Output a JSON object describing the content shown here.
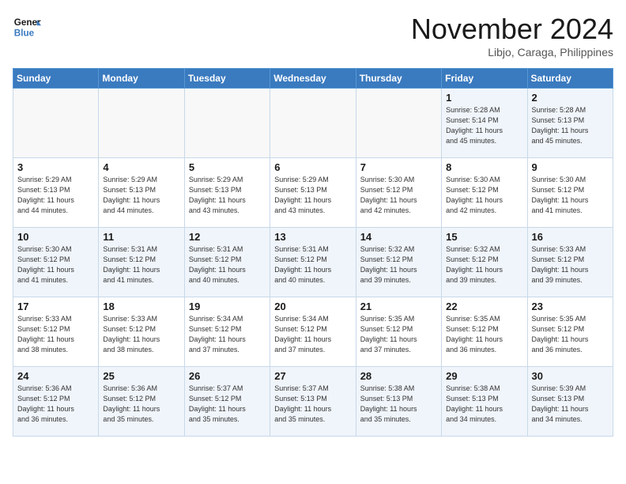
{
  "logo": {
    "line1": "General",
    "line2": "Blue"
  },
  "title": "November 2024",
  "location": "Libjo, Caraga, Philippines",
  "weekdays": [
    "Sunday",
    "Monday",
    "Tuesday",
    "Wednesday",
    "Thursday",
    "Friday",
    "Saturday"
  ],
  "weeks": [
    [
      {
        "day": "",
        "info": ""
      },
      {
        "day": "",
        "info": ""
      },
      {
        "day": "",
        "info": ""
      },
      {
        "day": "",
        "info": ""
      },
      {
        "day": "",
        "info": ""
      },
      {
        "day": "1",
        "info": "Sunrise: 5:28 AM\nSunset: 5:14 PM\nDaylight: 11 hours\nand 45 minutes."
      },
      {
        "day": "2",
        "info": "Sunrise: 5:28 AM\nSunset: 5:13 PM\nDaylight: 11 hours\nand 45 minutes."
      }
    ],
    [
      {
        "day": "3",
        "info": "Sunrise: 5:29 AM\nSunset: 5:13 PM\nDaylight: 11 hours\nand 44 minutes."
      },
      {
        "day": "4",
        "info": "Sunrise: 5:29 AM\nSunset: 5:13 PM\nDaylight: 11 hours\nand 44 minutes."
      },
      {
        "day": "5",
        "info": "Sunrise: 5:29 AM\nSunset: 5:13 PM\nDaylight: 11 hours\nand 43 minutes."
      },
      {
        "day": "6",
        "info": "Sunrise: 5:29 AM\nSunset: 5:13 PM\nDaylight: 11 hours\nand 43 minutes."
      },
      {
        "day": "7",
        "info": "Sunrise: 5:30 AM\nSunset: 5:12 PM\nDaylight: 11 hours\nand 42 minutes."
      },
      {
        "day": "8",
        "info": "Sunrise: 5:30 AM\nSunset: 5:12 PM\nDaylight: 11 hours\nand 42 minutes."
      },
      {
        "day": "9",
        "info": "Sunrise: 5:30 AM\nSunset: 5:12 PM\nDaylight: 11 hours\nand 41 minutes."
      }
    ],
    [
      {
        "day": "10",
        "info": "Sunrise: 5:30 AM\nSunset: 5:12 PM\nDaylight: 11 hours\nand 41 minutes."
      },
      {
        "day": "11",
        "info": "Sunrise: 5:31 AM\nSunset: 5:12 PM\nDaylight: 11 hours\nand 41 minutes."
      },
      {
        "day": "12",
        "info": "Sunrise: 5:31 AM\nSunset: 5:12 PM\nDaylight: 11 hours\nand 40 minutes."
      },
      {
        "day": "13",
        "info": "Sunrise: 5:31 AM\nSunset: 5:12 PM\nDaylight: 11 hours\nand 40 minutes."
      },
      {
        "day": "14",
        "info": "Sunrise: 5:32 AM\nSunset: 5:12 PM\nDaylight: 11 hours\nand 39 minutes."
      },
      {
        "day": "15",
        "info": "Sunrise: 5:32 AM\nSunset: 5:12 PM\nDaylight: 11 hours\nand 39 minutes."
      },
      {
        "day": "16",
        "info": "Sunrise: 5:33 AM\nSunset: 5:12 PM\nDaylight: 11 hours\nand 39 minutes."
      }
    ],
    [
      {
        "day": "17",
        "info": "Sunrise: 5:33 AM\nSunset: 5:12 PM\nDaylight: 11 hours\nand 38 minutes."
      },
      {
        "day": "18",
        "info": "Sunrise: 5:33 AM\nSunset: 5:12 PM\nDaylight: 11 hours\nand 38 minutes."
      },
      {
        "day": "19",
        "info": "Sunrise: 5:34 AM\nSunset: 5:12 PM\nDaylight: 11 hours\nand 37 minutes."
      },
      {
        "day": "20",
        "info": "Sunrise: 5:34 AM\nSunset: 5:12 PM\nDaylight: 11 hours\nand 37 minutes."
      },
      {
        "day": "21",
        "info": "Sunrise: 5:35 AM\nSunset: 5:12 PM\nDaylight: 11 hours\nand 37 minutes."
      },
      {
        "day": "22",
        "info": "Sunrise: 5:35 AM\nSunset: 5:12 PM\nDaylight: 11 hours\nand 36 minutes."
      },
      {
        "day": "23",
        "info": "Sunrise: 5:35 AM\nSunset: 5:12 PM\nDaylight: 11 hours\nand 36 minutes."
      }
    ],
    [
      {
        "day": "24",
        "info": "Sunrise: 5:36 AM\nSunset: 5:12 PM\nDaylight: 11 hours\nand 36 minutes."
      },
      {
        "day": "25",
        "info": "Sunrise: 5:36 AM\nSunset: 5:12 PM\nDaylight: 11 hours\nand 35 minutes."
      },
      {
        "day": "26",
        "info": "Sunrise: 5:37 AM\nSunset: 5:12 PM\nDaylight: 11 hours\nand 35 minutes."
      },
      {
        "day": "27",
        "info": "Sunrise: 5:37 AM\nSunset: 5:13 PM\nDaylight: 11 hours\nand 35 minutes."
      },
      {
        "day": "28",
        "info": "Sunrise: 5:38 AM\nSunset: 5:13 PM\nDaylight: 11 hours\nand 35 minutes."
      },
      {
        "day": "29",
        "info": "Sunrise: 5:38 AM\nSunset: 5:13 PM\nDaylight: 11 hours\nand 34 minutes."
      },
      {
        "day": "30",
        "info": "Sunrise: 5:39 AM\nSunset: 5:13 PM\nDaylight: 11 hours\nand 34 minutes."
      }
    ]
  ]
}
